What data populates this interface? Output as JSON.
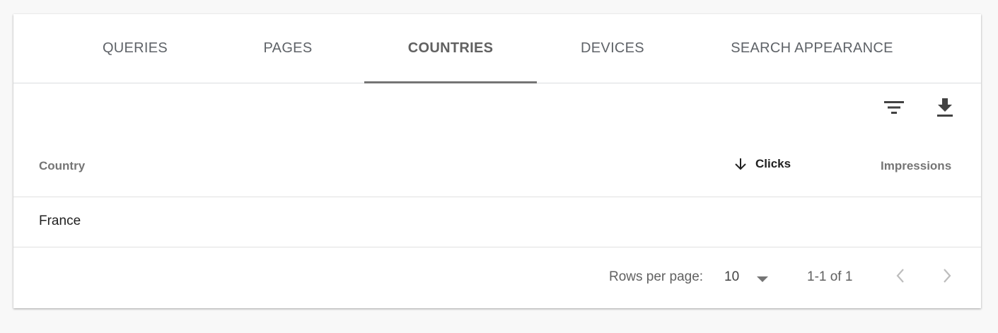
{
  "tabs": [
    {
      "label": "QUERIES",
      "active": false
    },
    {
      "label": "PAGES",
      "active": false
    },
    {
      "label": "COUNTRIES",
      "active": true
    },
    {
      "label": "DEVICES",
      "active": false
    },
    {
      "label": "SEARCH APPEARANCE",
      "active": false
    }
  ],
  "toolbar": {
    "filter_icon": "filter-icon",
    "download_icon": "download-icon"
  },
  "table": {
    "columns": [
      "Country",
      "Clicks",
      "Impressions"
    ],
    "sort_column": "Clicks",
    "sort_direction": "descending",
    "rows": [
      {
        "country": "France",
        "clicks": "",
        "impressions": ""
      }
    ]
  },
  "pagination": {
    "rows_per_page_label": "Rows per page:",
    "rows_per_page_value": "10",
    "range_text": "1-1 of 1"
  },
  "colors": {
    "active_tab_indicator": "#757575",
    "background": "#f8f8f8",
    "card": "#ffffff"
  }
}
